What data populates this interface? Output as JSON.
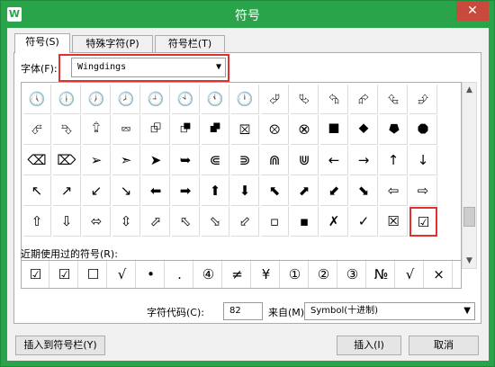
{
  "window": {
    "title": "符号",
    "app_icon": "W",
    "close_label": "✕"
  },
  "tabs": [
    {
      "label": "符号(S)"
    },
    {
      "label": "特殊字符(P)"
    },
    {
      "label": "符号栏(T)"
    }
  ],
  "font": {
    "label": "字体(F):",
    "value": "Wingdings",
    "arrow": "▼"
  },
  "symbols_rows": [
    [
      "🕔",
      "🕕",
      "🕖",
      "🕗",
      "🕘",
      "🕙",
      "🕚",
      "🕛",
      "⮰",
      "⮱",
      "⮲",
      "⮳",
      "⮴",
      "⮵"
    ],
    [
      "⮶",
      "⮷",
      "⮸",
      "⮹",
      "⮺",
      "⮻",
      "⮼",
      "⮽",
      "⮾",
      "⮿",
      "⯀",
      "⯁",
      "⯂",
      "⯃"
    ],
    [
      "⌫",
      "⌦",
      "➢",
      "➣",
      "➤",
      "➥",
      "⋐",
      "⋑",
      "⋒",
      "⋓",
      "←",
      "→",
      "↑",
      "↓"
    ],
    [
      "↖",
      "↗",
      "↙",
      "↘",
      "⬅",
      "➡",
      "⬆",
      "⬇",
      "⬉",
      "⬈",
      "⬋",
      "⬊",
      "⇦",
      "⇨"
    ],
    [
      "⇧",
      "⇩",
      "⬄",
      "⇳",
      "⬀",
      "⬁",
      "⬂",
      "⬃",
      "▫",
      "▪",
      "✗",
      "✓",
      "☒",
      "☑"
    ]
  ],
  "selected_symbol": "☑",
  "recent_label": "近期使用过的符号(R):",
  "recent_symbols": [
    "☑",
    "☑",
    "☐",
    "√",
    "•",
    ".",
    "④",
    "≠",
    "¥",
    "①",
    "②",
    "③",
    "№",
    "√",
    "×"
  ],
  "char_code": {
    "label": "字符代码(C):",
    "value": "82",
    "from_label": "来自(M)",
    "from_value": "Symbol(十进制)",
    "from_arrow": "▼"
  },
  "buttons": {
    "insert_to_bar": "插入到符号栏(Y)",
    "insert": "插入(I)",
    "cancel": "取消"
  },
  "scroll": {
    "up": "▲",
    "down": "▼"
  }
}
